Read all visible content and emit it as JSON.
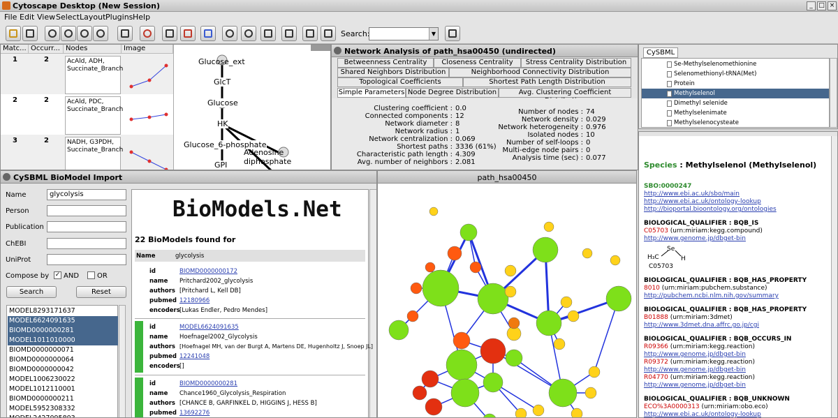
{
  "window": {
    "title": "Cytoscape Desktop (New Session)"
  },
  "menu": [
    "File",
    "Edit",
    "View",
    "Select",
    "Layout",
    "Plugins",
    "Help"
  ],
  "toolbar": {
    "search_label": "Search:"
  },
  "match_table": {
    "headers": [
      "Matc...",
      "Occurr...",
      "Nodes",
      "Image"
    ],
    "rows": [
      {
        "idx": "1",
        "occ": "2",
        "nodes": "AcAld, ADH, Succinate_Branch"
      },
      {
        "idx": "2",
        "occ": "2",
        "nodes": "AcAld, PDC, Succinate_Branch"
      },
      {
        "idx": "3",
        "occ": "2",
        "nodes": "NADH, G3PDH, Succinate_Branch"
      }
    ]
  },
  "pathway": {
    "nodes": [
      "Glucose_ext",
      "GlcT",
      "Glucose",
      "HK",
      "Glucose_6-phosphate",
      "Adenosine diphosphate",
      "GPI"
    ]
  },
  "network_analysis": {
    "title": "Network Analysis of path_hsa00450 (undirected)",
    "tabs_row1": [
      "Betweenness Centrality",
      "Closeness Centrality",
      "Stress Centrality Distribution"
    ],
    "tabs_row2": [
      "Shared Neighbors Distribution",
      "Neighborhood Connectivity Distribution"
    ],
    "tabs_row3": [
      "Topological Coefficients",
      "Shortest Path Length Distribution"
    ],
    "tabs_row4": [
      "Simple Parameters",
      "Node Degree Distribution",
      "Avg. Clustering Coefficient Distribution"
    ],
    "left": [
      {
        "k": "Clustering coefficient :",
        "v": "0.0"
      },
      {
        "k": "Connected components :",
        "v": "12"
      },
      {
        "k": "Network diameter :",
        "v": "8"
      },
      {
        "k": "Network radius :",
        "v": "1"
      },
      {
        "k": "Network centralization :",
        "v": "0.069"
      },
      {
        "k": "Shortest paths :",
        "v": "3336 (61%)"
      },
      {
        "k": "Characteristic path length :",
        "v": "4.309"
      },
      {
        "k": "Avg. number of neighbors :",
        "v": "2.081"
      }
    ],
    "right": [
      {
        "k": "Number of nodes :",
        "v": "74"
      },
      {
        "k": "Network density :",
        "v": "0.029"
      },
      {
        "k": "Network heterogeneity :",
        "v": "0.976"
      },
      {
        "k": "Isolated nodes :",
        "v": "10"
      },
      {
        "k": "Number of self-loops :",
        "v": "0"
      },
      {
        "k": "Multi-edge node pairs :",
        "v": "0"
      },
      {
        "k": "Analysis time (sec) :",
        "v": "0.077"
      }
    ]
  },
  "cysbml": {
    "tab": "CySBML",
    "tree": [
      "Se-Methylselenomethionine",
      "Selenomethionyl-tRNA(Met)",
      "Protein",
      "Methylselenol",
      "Dimethyl selenide",
      "Methylselenimate",
      "Methylselenocysteate"
    ],
    "selected": 3,
    "species": {
      "label": "Species",
      "name": ": Methylselenol (Methylselenol)",
      "sbo": "SBO:0000247",
      "links1": [
        "http://www.ebi.ac.uk/sbo/main",
        "http://www.ebi.ac.uk/ontology-lookup",
        "http://bioportal.bioontology.org/ontologies"
      ],
      "q1": "BIOLOGICAL_QUALIFIER : BQB_IS",
      "q1a": "C05703",
      "q1b": "(urn:miriam:kegg.compound)",
      "q1link": "http://www.genome.jp/dbget-bin",
      "struct": "C05703",
      "q2": "BIOLOGICAL_QUALIFIER : BQB_HAS_PROPERTY",
      "q2a": "8010",
      "q2b": "(urn:miriam:pubchem.substance)",
      "q2link": "http://pubchem.ncbi.nlm.nih.gov/summary",
      "q3": "BIOLOGICAL_QUALIFIER : BQB_HAS_PROPERTY",
      "q3a": "B01888",
      "q3b": "(urn:miriam:3dmet)",
      "q3link": "http://www.3dmet.dna.affrc.go.jp/cgi",
      "q4": "BIOLOGICAL_QUALIFIER : BQB_OCCURS_IN",
      "q4items": [
        [
          "R09366",
          "(urn:miriam:kegg.reaction)",
          "http://www.genome.jp/dbget-bin"
        ],
        [
          "R09372",
          "(urn:miriam:kegg.reaction)",
          "http://www.genome.jp/dbget-bin"
        ],
        [
          "R04770",
          "(urn:miriam:kegg.reaction)",
          "http://www.genome.jp/dbget-bin"
        ]
      ],
      "q5": "BIOLOGICAL_QUALIFIER : BQB_UNKNOWN",
      "q5a": "ECO%3A0000313",
      "q5b": "(urn:miriam:obo.eco)",
      "q5links": [
        "http://www.ebi.ac.uk/ontology-lookup",
        "http://bioportal.bioontology.org/ontologies"
      ]
    }
  },
  "biomodel": {
    "title": "CySBML BioModel Import",
    "fields": [
      {
        "label": "Name",
        "value": "glycolysis"
      },
      {
        "label": "Person",
        "value": ""
      },
      {
        "label": "Publication",
        "value": ""
      },
      {
        "label": "ChEBI",
        "value": ""
      },
      {
        "label": "UniProt",
        "value": ""
      }
    ],
    "compose_label": "Compose by",
    "and": "AND",
    "or": "OR",
    "search_btn": "Search",
    "reset_btn": "Reset",
    "models": [
      "MODEL8293171637",
      "MODEL6624091635",
      "BIOMD0000000281",
      "MODEL1011010000",
      "BIOMD0000000071",
      "BIOMD0000000064",
      "BIOMD0000000042",
      "MODEL1006230022",
      "MODEL1012110001",
      "BIOMD0000000211",
      "MODEL5952308332",
      "MODEL2427095803"
    ],
    "selected": [
      1,
      2,
      3
    ],
    "logo": "BioModels.Net",
    "found": "22 BioModels found for",
    "query_name_key": "Name",
    "query_name_val": "glycolysis",
    "results": [
      {
        "id": "BIOMD0000000172",
        "name": "Pritchard2002_glycolysis",
        "authors": "[Pritchard L, Kell DB]",
        "pubmed": "12180966",
        "encoders": "[Lukas Endler, Pedro Mendes]"
      },
      {
        "id": "MODEL6624091635",
        "name": "Hoefnagel2002_Glycolysis",
        "authors": "[Hoefnagel MH, van der Burgt A, Martens DE, Hugenholtz J, Snoep JL]",
        "pubmed": "12241048",
        "encoders": "[]"
      },
      {
        "id": "BIOMD0000000281",
        "name": "Chance1960_Glycolysis_Respiration",
        "authors": "[CHANCE B, GARFINKEL D, HIGGINS J, HESS B]",
        "pubmed": "13692276"
      }
    ],
    "keys": {
      "id": "id",
      "name": "name",
      "authors": "authors",
      "pubmed": "pubmed",
      "encoders": "encoders"
    }
  },
  "graph": {
    "title": "path_hsa00450"
  }
}
